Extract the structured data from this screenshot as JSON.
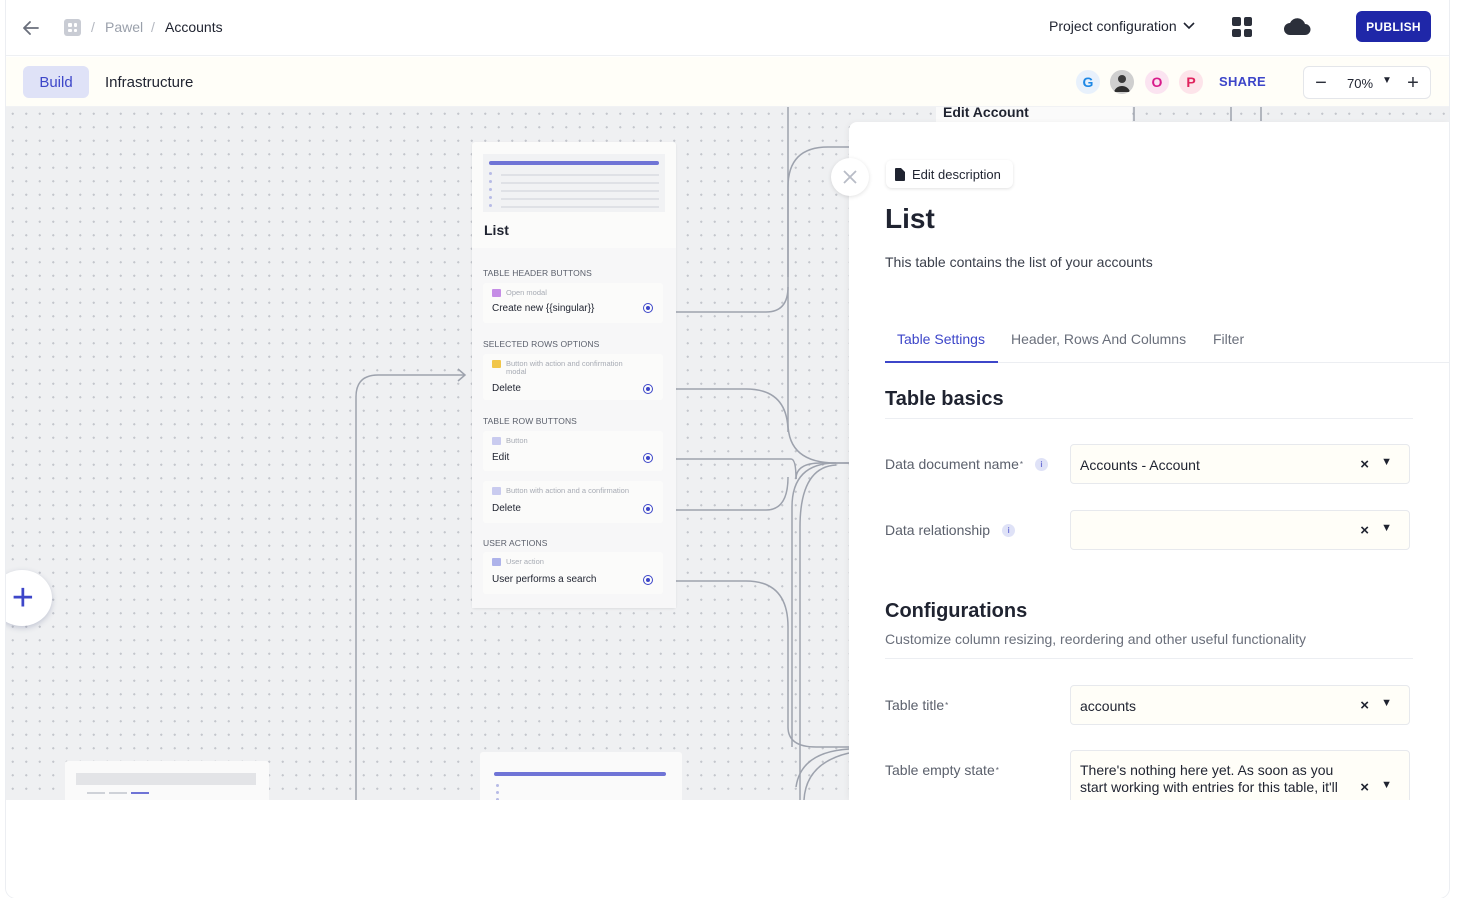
{
  "breadcrumb": {
    "sep": "/",
    "parent": "Pawel",
    "current": "Accounts"
  },
  "topbar": {
    "project_config": "Project configuration",
    "publish": "PUBLISH"
  },
  "tabs": {
    "build": "Build",
    "infrastructure": "Infrastructure"
  },
  "collaborators": [
    {
      "letter": "G",
      "color": "#1e88e5",
      "bg": "#e8f1fc"
    },
    {
      "letter": "",
      "color": "#333333",
      "bg": "#d5d5d5"
    },
    {
      "letter": "O",
      "color": "#d81b8a",
      "bg": "#fbe4f1"
    },
    {
      "letter": "P",
      "color": "#e0245e",
      "bg": "#fde4ea"
    }
  ],
  "share": "SHARE",
  "zoom": {
    "minus": "−",
    "value": "70%",
    "plus": "+"
  },
  "canvas": {
    "edit_account": "Edit Account",
    "list_card": {
      "title": "List",
      "sections": {
        "header_buttons": "TABLE HEADER BUTTONS",
        "selected_rows": "SELECTED ROWS OPTIONS",
        "row_buttons": "TABLE ROW BUTTONS",
        "user_actions": "USER ACTIONS"
      },
      "items": {
        "create_new": {
          "type": "Open modal",
          "label": "Create new {{singular}}"
        },
        "delete_selected": {
          "type": "Button with action and confirmation modal",
          "label": "Delete"
        },
        "edit_row": {
          "type": "Button",
          "label": "Edit"
        },
        "delete_row": {
          "type": "Button with action and a confirmation",
          "label": "Delete"
        },
        "search": {
          "type": "User action",
          "label": "User performs a search"
        }
      }
    },
    "add_icon": "+"
  },
  "panel": {
    "edit_description": "Edit description",
    "title": "List",
    "subtitle": "This table contains the list of your accounts",
    "tabs": [
      "Table Settings",
      "Header, Rows And Columns",
      "Filter"
    ],
    "basics": {
      "heading": "Table basics",
      "doc_name_label": "Data document name",
      "doc_name_value": "Accounts - Account",
      "relationship_label": "Data relationship",
      "relationship_value": ""
    },
    "config": {
      "heading": "Configurations",
      "sub": "Customize column resizing, reordering and other useful functionality",
      "table_title_label": "Table title",
      "table_title_value": "accounts",
      "empty_state_label": "Table empty state",
      "empty_state_value": "There's nothing here yet. As soon as you start working with entries for this table, it'll"
    },
    "required_mark": "*",
    "clear": "×",
    "info": "i"
  }
}
